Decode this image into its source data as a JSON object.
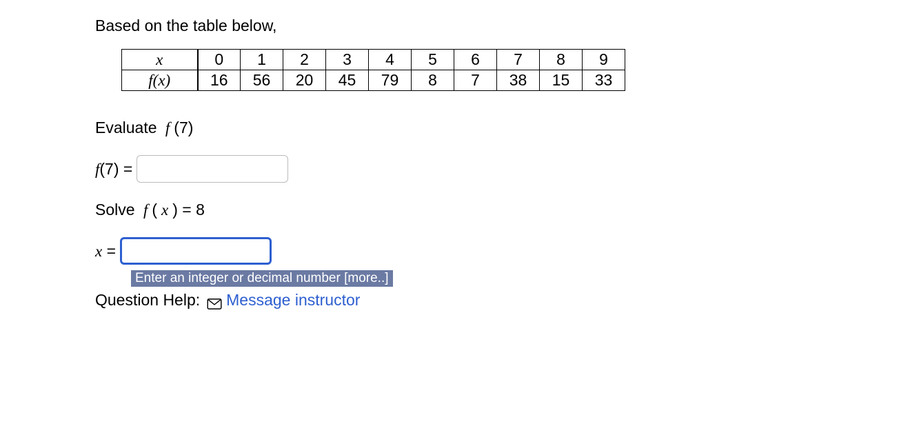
{
  "prompt": "Based on the table below,",
  "table": {
    "row1_label": "x",
    "row2_label": "f(x)",
    "x": [
      "0",
      "1",
      "2",
      "3",
      "4",
      "5",
      "6",
      "7",
      "8",
      "9"
    ],
    "fx": [
      "16",
      "56",
      "20",
      "45",
      "79",
      "8",
      "7",
      "38",
      "15",
      "33"
    ]
  },
  "q1": {
    "label": "Evaluate f(7)",
    "answer_label": "f(7) = "
  },
  "q2": {
    "label": "Solve f(x) = 8",
    "answer_label": "x = ",
    "hint": "Enter an integer or decimal number [more..]"
  },
  "help": {
    "label": "Question Help:",
    "msg": "Message instructor"
  }
}
